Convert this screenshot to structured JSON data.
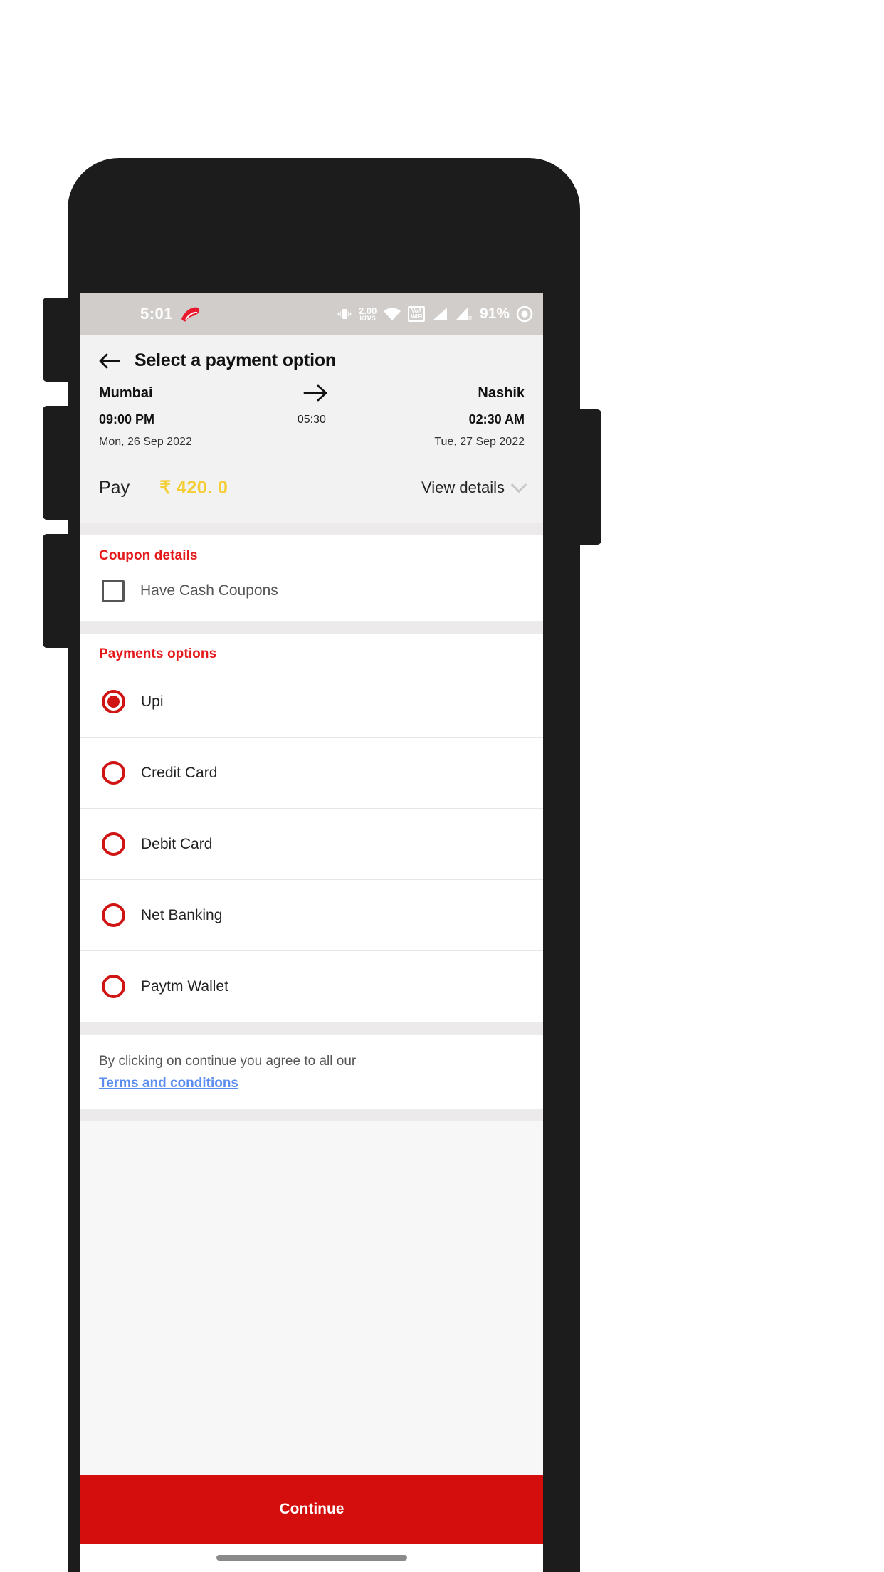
{
  "status_bar": {
    "time": "5:01",
    "carrier_logo": "airtel-logo",
    "vibrate_icon": "vibrate-icon",
    "data_rate": "2.00",
    "data_rate_unit": "KB/S",
    "wifi_icon": "wifi-icon",
    "vowifi_badge_line1": "VoA",
    "vowifi_badge_line2": "WiFi",
    "signal_icon_1": "signal-bars-icon",
    "signal_icon_2": "signal-bars-roaming-icon",
    "battery_percent": "91%",
    "battery_icon": "battery-circle-icon"
  },
  "appbar": {
    "back_icon": "back-arrow-icon",
    "title": "Select a payment option"
  },
  "journey": {
    "origin_city": "Mumbai",
    "origin_time": "09:00 PM",
    "origin_date": "Mon, 26 Sep 2022",
    "arrow_icon": "arrow-right-icon",
    "duration": "05:30",
    "destination_city": "Nashik",
    "destination_time": "02:30 AM",
    "destination_date": "Tue, 27 Sep 2022"
  },
  "pay": {
    "label": "Pay",
    "amount": "₹ 420. 0",
    "amount_color": "#f5ce35",
    "view_details_label": "View details",
    "chevron_icon": "chevron-down-icon"
  },
  "coupon": {
    "section_title": "Coupon details",
    "checkbox_label": "Have Cash Coupons",
    "checkbox_icon": "checkbox-unchecked-icon",
    "checked": false
  },
  "payments": {
    "section_title": "Payments options",
    "options": [
      {
        "label": "Upi",
        "selected": true,
        "icon": "radio-selected-icon"
      },
      {
        "label": "Credit Card",
        "selected": false,
        "icon": "radio-unselected-icon"
      },
      {
        "label": "Debit Card",
        "selected": false,
        "icon": "radio-unselected-icon"
      },
      {
        "label": "Net Banking",
        "selected": false,
        "icon": "radio-unselected-icon"
      },
      {
        "label": "Paytm Wallet",
        "selected": false,
        "icon": "radio-unselected-icon"
      }
    ]
  },
  "terms": {
    "text": "By clicking on continue you agree to all our",
    "link": "Terms and conditions",
    "link_color": "#5b8def"
  },
  "footer": {
    "continue_label": "Continue",
    "continue_color": "#d40d0d",
    "home_indicator": "home-indicator"
  },
  "theme": {
    "accent_red": "#e51919",
    "section_header_red": "#e51919",
    "radio_red": "#d01414"
  }
}
